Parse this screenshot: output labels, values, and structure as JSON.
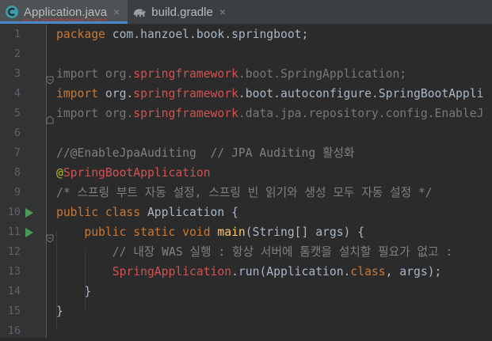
{
  "tabs": [
    {
      "label": "Application.java",
      "close": "×",
      "icon": "java-class-icon",
      "active": true
    },
    {
      "label": "build.gradle",
      "close": "×",
      "icon": "gradle-elephant-icon",
      "active": false
    }
  ],
  "lines": [
    {
      "num": "1",
      "seg": [
        "package",
        " com.hanzoel.book.springboot;"
      ]
    },
    {
      "num": "2"
    },
    {
      "num": "3",
      "seg": [
        "import",
        " org.",
        "springframework",
        ".boot.SpringApplication;"
      ]
    },
    {
      "num": "4",
      "seg": [
        "import",
        " org.",
        "springframework",
        ".boot.autoconfigure.SpringBootAppli"
      ]
    },
    {
      "num": "5",
      "seg": [
        "import",
        " org.",
        "springframework",
        ".data.jpa.repository.config.EnableJ"
      ]
    },
    {
      "num": "6"
    },
    {
      "num": "7",
      "seg": [
        "//@EnableJpaAuditing  // JPA Auditing 활성화"
      ]
    },
    {
      "num": "8",
      "seg": [
        "@",
        "SpringBootApplication"
      ]
    },
    {
      "num": "9",
      "seg": [
        "/* 스프링 부트 자동 설정, 스프링 빈 읽기와 생성 모두 자동 설정 */"
      ]
    },
    {
      "num": "10",
      "seg": [
        "public class",
        " Application {"
      ]
    },
    {
      "num": "11",
      "seg": [
        "    ",
        "public static void",
        " ",
        "main",
        "(String[] args) {"
      ]
    },
    {
      "num": "12",
      "seg": [
        "        // 내장 WAS 실행 : 항상 서버에 톰캣을 설치할 필요가 없고 ",
        ":"
      ]
    },
    {
      "num": "13",
      "seg": [
        "        ",
        "SpringApplication",
        ".run(Application.",
        "class",
        ", args);"
      ]
    },
    {
      "num": "14",
      "seg": [
        "    }"
      ]
    },
    {
      "num": "15",
      "seg": [
        "}"
      ]
    },
    {
      "num": "16"
    }
  ],
  "colors": {
    "background": "#2b2b2b",
    "keyword": "#cc7832",
    "comment": "#808080",
    "annotation": "#bbb529",
    "spring_highlight": "#d25252",
    "method": "#ffc66d",
    "plain": "#a9b7c6",
    "run_marker": "#499c54"
  },
  "gutter_icons": {
    "run": "run-arrow-icon",
    "fold": "fold-marker-icon"
  }
}
